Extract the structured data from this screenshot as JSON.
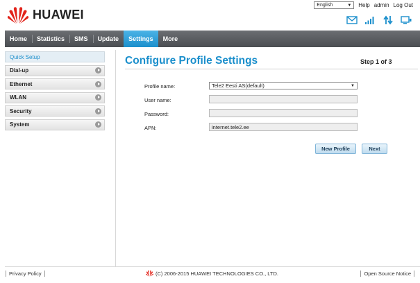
{
  "header": {
    "brand": "HUAWEI",
    "language": "English",
    "links": {
      "help": "Help",
      "user": "admin",
      "logout": "Log Out"
    }
  },
  "nav": {
    "items": [
      {
        "label": "Home"
      },
      {
        "label": "Statistics"
      },
      {
        "label": "SMS"
      },
      {
        "label": "Update"
      },
      {
        "label": "Settings",
        "active": true
      },
      {
        "label": "More"
      }
    ]
  },
  "sidebar": {
    "items": [
      {
        "label": "Quick Setup",
        "active": true
      },
      {
        "label": "Dial-up"
      },
      {
        "label": "Ethernet"
      },
      {
        "label": "WLAN"
      },
      {
        "label": "Security"
      },
      {
        "label": "System"
      }
    ]
  },
  "main": {
    "title": "Configure Profile Settings",
    "step": "Step 1 of 3",
    "form": {
      "profile_name_label": "Profile name:",
      "profile_name_value": "Tele2 Eesti AS(default)",
      "username_label": "User name:",
      "username_value": "",
      "password_label": "Password:",
      "password_value": "",
      "apn_label": "APN:",
      "apn_value": "internet.tele2.ee"
    },
    "buttons": {
      "new_profile": "New Profile",
      "next": "Next"
    }
  },
  "footer": {
    "privacy": "Privacy Policy",
    "copyright": "(C) 2006-2015 HUAWEI TECHNOLOGIES CO., LTD.",
    "open_source": "Open Source Notice"
  },
  "colors": {
    "accent": "#1b8fcc",
    "nav_bg": "#5a5d61",
    "brand_red": "#e2231a"
  },
  "icons": [
    "huawei-logo",
    "mail-icon",
    "signal-icon",
    "data-transfer-icon",
    "pc-connection-icon"
  ]
}
